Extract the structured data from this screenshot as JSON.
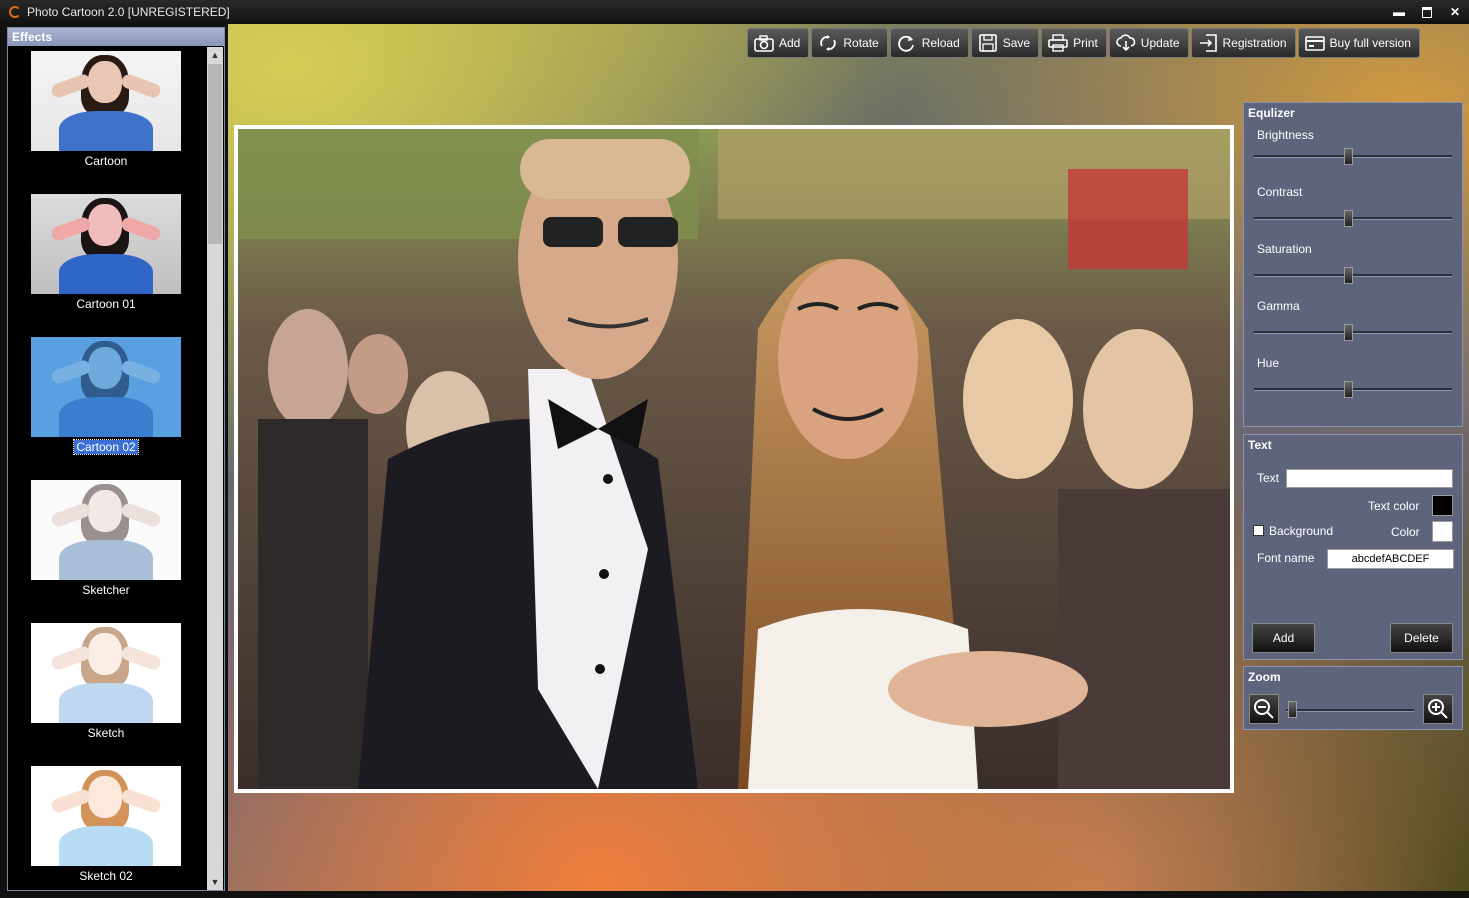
{
  "window": {
    "title": "Photo Cartoon 2.0 [UNREGISTERED]",
    "controls": [
      "minimize",
      "maximize",
      "close"
    ]
  },
  "effects": {
    "header": "Effects",
    "items": [
      {
        "label": "Cartoon",
        "selected": false
      },
      {
        "label": "Cartoon 01",
        "selected": false
      },
      {
        "label": "Cartoon 02",
        "selected": true
      },
      {
        "label": "Sketcher",
        "selected": false
      },
      {
        "label": "Sketch",
        "selected": false
      },
      {
        "label": "Sketch 02",
        "selected": false
      }
    ]
  },
  "toolbar": {
    "buttons": [
      {
        "label": "Add",
        "icon": "camera-icon"
      },
      {
        "label": "Rotate",
        "icon": "rotate-icon"
      },
      {
        "label": "Reload",
        "icon": "reload-icon"
      },
      {
        "label": "Save",
        "icon": "floppy-icon"
      },
      {
        "label": "Print",
        "icon": "printer-icon"
      },
      {
        "label": "Update",
        "icon": "cloud-download-icon"
      },
      {
        "label": "Registration",
        "icon": "login-icon"
      },
      {
        "label": "Buy full version",
        "icon": "card-icon"
      }
    ]
  },
  "equalizer": {
    "title": "Equlizer",
    "sliders": [
      {
        "label": "Brightness",
        "value": 0.5
      },
      {
        "label": "Contrast",
        "value": 0.5
      },
      {
        "label": "Saturation",
        "value": 0.5
      },
      {
        "label": "Gamma",
        "value": 0.5
      },
      {
        "label": "Hue",
        "value": 0.5
      }
    ]
  },
  "text_panel": {
    "title": "Text",
    "text_label": "Text",
    "text_value": "",
    "text_color_label": "Text color",
    "text_color": "#000000",
    "background_label": "Background",
    "background_checked": false,
    "color_label": "Color",
    "bg_color": "#ffffff",
    "font_name_label": "Font name",
    "font_preview": "abcdefABCDEF",
    "add_label": "Add",
    "delete_label": "Delete"
  },
  "zoom": {
    "title": "Zoom",
    "value": 0.0
  },
  "colors": {
    "panel_bg": "#5d647c",
    "selection": "#3b6fd6",
    "accent": "#e06a1c"
  }
}
